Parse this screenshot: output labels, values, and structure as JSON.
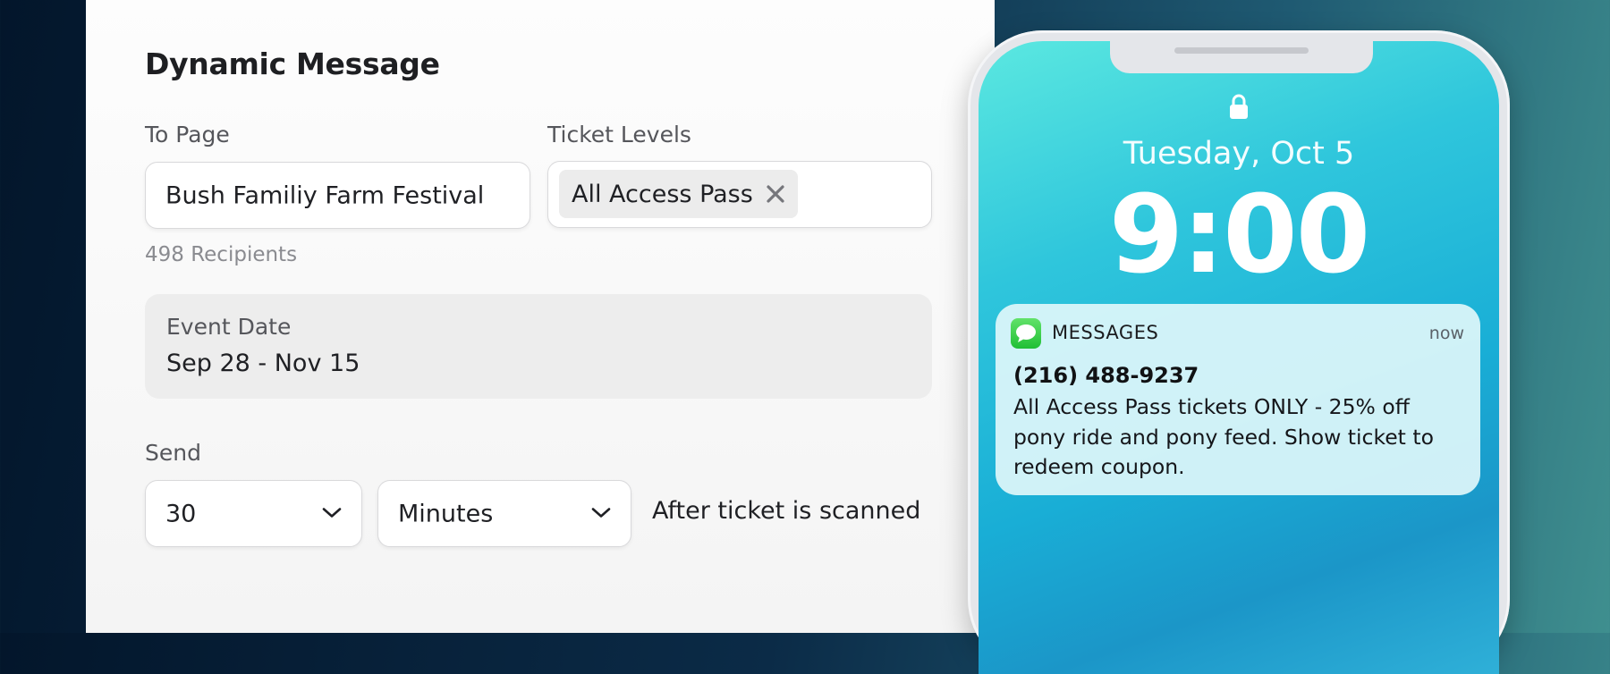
{
  "form": {
    "title": "Dynamic Message",
    "to_page": {
      "label": "To Page",
      "value": "Bush Familiy Farm Festival"
    },
    "ticket_levels": {
      "label": "Ticket Levels",
      "chips": [
        "All Access Pass"
      ]
    },
    "recipients": "498 Recipients",
    "event_date": {
      "label": "Event Date",
      "value": "Sep 28 - Nov 15"
    },
    "send": {
      "label": "Send",
      "amount": "30",
      "unit": "Minutes",
      "suffix": "After ticket is scanned"
    }
  },
  "phone": {
    "date": "Tuesday, Oct 5",
    "time": "9:00",
    "notification": {
      "app": "MESSAGES",
      "time": "now",
      "sender": "(216) 488-9237",
      "body": "All Access Pass tickets ONLY - 25% off pony ride and pony feed. Show ticket to redeem coupon."
    }
  },
  "icons": [
    "close-icon",
    "chevron-down-icon",
    "lock-icon",
    "messages-app-icon"
  ]
}
